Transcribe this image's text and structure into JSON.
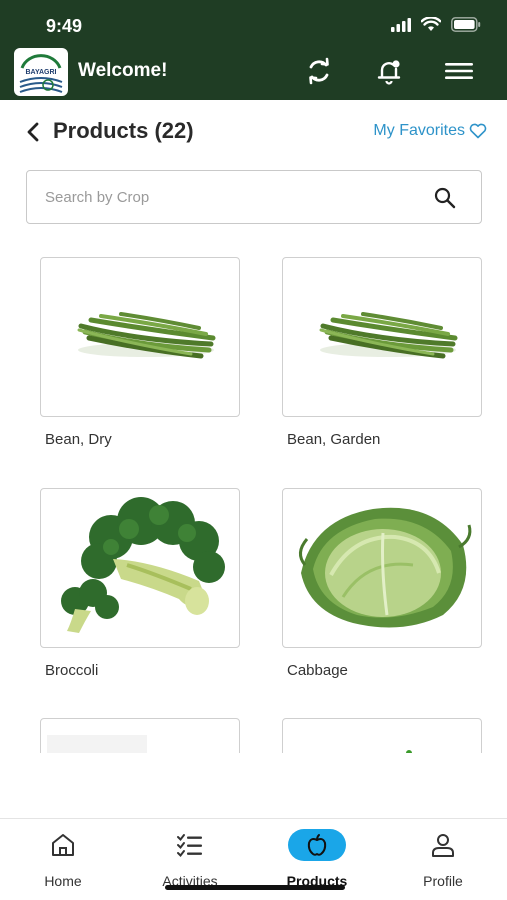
{
  "status_bar": {
    "time": "9:49"
  },
  "header": {
    "logo_text": "BAYAGRI",
    "welcome": "Welcome!"
  },
  "page": {
    "title": "Products (22)",
    "favorites_label": "My Favorites"
  },
  "search": {
    "placeholder": "Search by Crop"
  },
  "products": [
    {
      "name": "Bean, Dry",
      "icon": "green-beans-image"
    },
    {
      "name": "Bean, Garden",
      "icon": "green-beans-image"
    },
    {
      "name": "Broccoli",
      "icon": "broccoli-image"
    },
    {
      "name": "Cabbage",
      "icon": "cabbage-image"
    }
  ],
  "tabs": [
    {
      "label": "Home",
      "icon": "home-icon",
      "active": false
    },
    {
      "label": "Activities",
      "icon": "checklist-icon",
      "active": false
    },
    {
      "label": "Products",
      "icon": "apple-icon",
      "active": true
    },
    {
      "label": "Profile",
      "icon": "person-icon",
      "active": false
    }
  ],
  "colors": {
    "header_bg": "#1f3d24",
    "accent_blue": "#1aa6e8",
    "link_blue": "#2e93c9"
  }
}
